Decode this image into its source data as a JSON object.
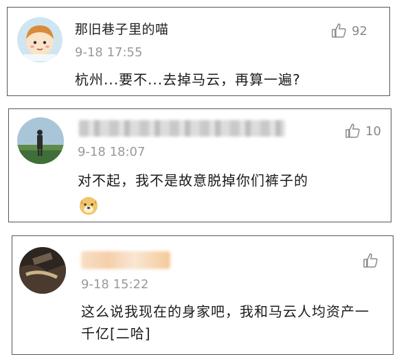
{
  "comments": [
    {
      "username": "那旧巷子里的喵",
      "time": "9-18 17:55",
      "text": "杭州...要不...去掉马云，再算一遍?",
      "likes": "92"
    },
    {
      "time": "9-18 18:07",
      "text": "对不起，我不是故意脱掉你们裤子的",
      "likes": "10"
    },
    {
      "time": "9-18 15:22",
      "text": "这么说我现在的身家吧，我和马云人均资产一千亿[二哈]",
      "likes": ""
    }
  ]
}
